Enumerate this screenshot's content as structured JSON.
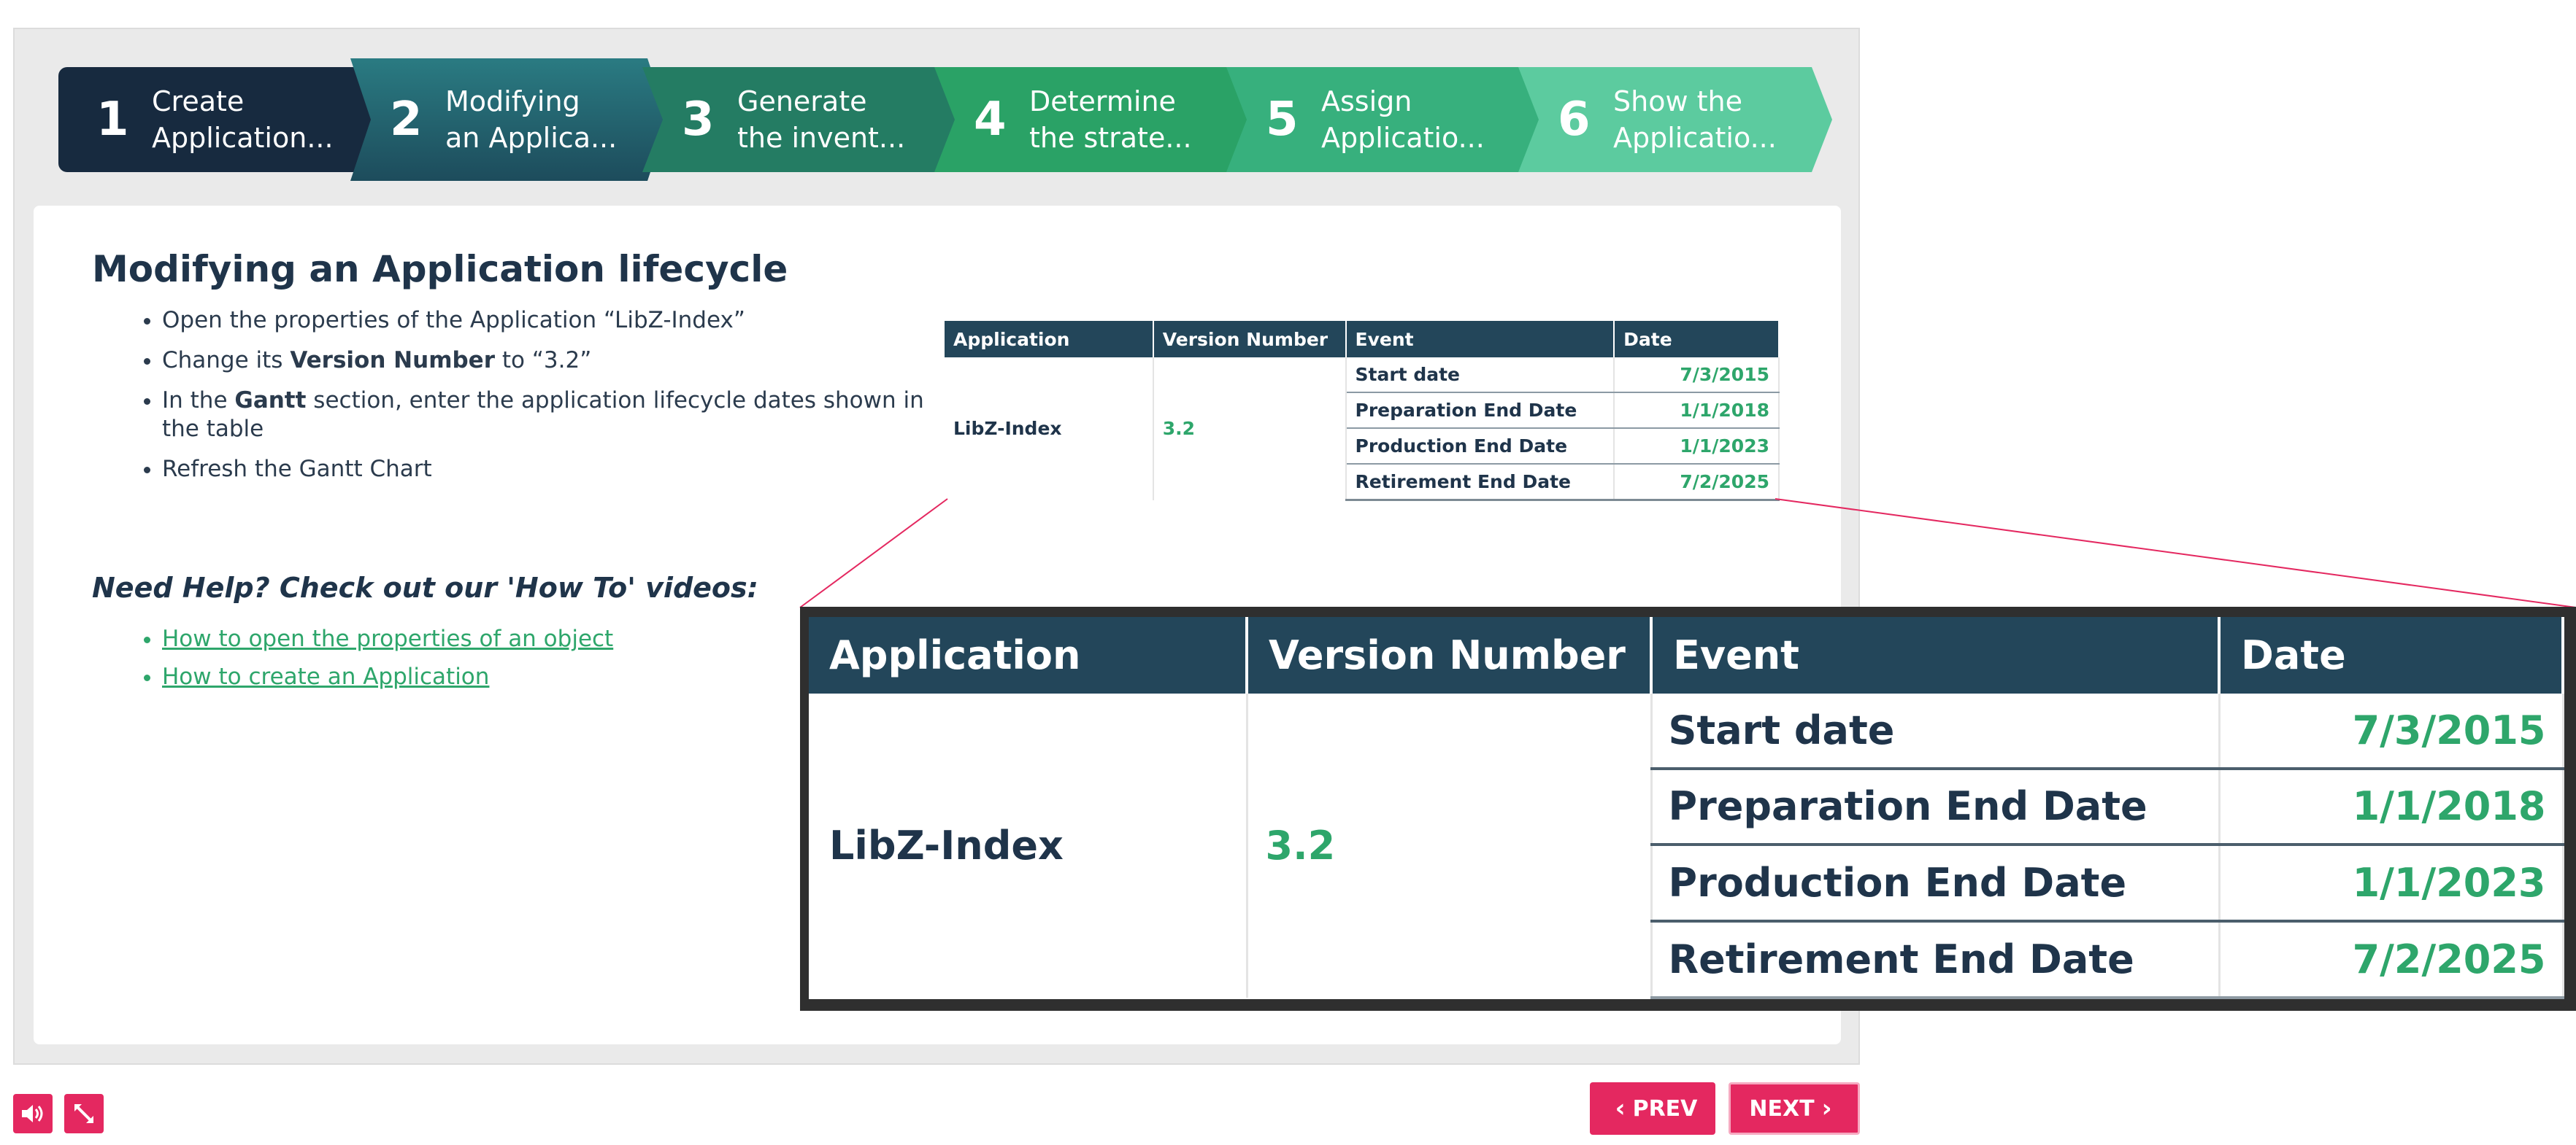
{
  "steps": [
    {
      "num": "1",
      "label": "Create\nApplication...",
      "color": "#172a3f"
    },
    {
      "num": "2",
      "label": "Modifying\nan Applica...",
      "color": "#1e5662"
    },
    {
      "num": "3",
      "label": "Generate\nthe invent...",
      "color": "#247c63"
    },
    {
      "num": "4",
      "label": "Determine\nthe strate...",
      "color": "#2aa266"
    },
    {
      "num": "5",
      "label": "Assign\nApplicatio...",
      "color": "#37b07d"
    },
    {
      "num": "6",
      "label": "Show the\nApplicatio...",
      "color": "#5ccb9f"
    }
  ],
  "active_step": "2",
  "content": {
    "title": "Modifying an Application lifecycle",
    "instructions": [
      {
        "pre": "Open the properties of the Application “LibZ-Index”",
        "bold": "",
        "post": ""
      },
      {
        "pre": "Change its ",
        "bold": "Version Number",
        "post": " to “3.2”"
      },
      {
        "pre": "In the ",
        "bold": "Gantt",
        "post": " section, enter the application lifecycle dates shown in the table"
      },
      {
        "pre": "Refresh the Gantt Chart",
        "bold": "",
        "post": ""
      }
    ],
    "help_title": "Need Help? Check out our 'How To' videos:",
    "help_links": [
      "How to open the properties of an object",
      "How to create an Application"
    ]
  },
  "table": {
    "headers": [
      "Application",
      "Version Number",
      "Event",
      "Date"
    ],
    "application": "LibZ-Index",
    "version": "3.2",
    "rows": [
      {
        "event": "Start date",
        "date": "7/3/2015"
      },
      {
        "event": "Preparation End Date",
        "date": "1/1/2018"
      },
      {
        "event": "Production End Date",
        "date": "1/1/2023"
      },
      {
        "event": "Retirement End Date",
        "date": "7/2/2025"
      }
    ]
  },
  "footer": {
    "prev_label": "PREV",
    "next_label": "NEXT",
    "audio_icon": "speaker-icon",
    "fullscreen_icon": "expand-icon"
  },
  "colors": {
    "accent": "#e42860",
    "link": "#2ea66b",
    "header": "#23465a"
  }
}
